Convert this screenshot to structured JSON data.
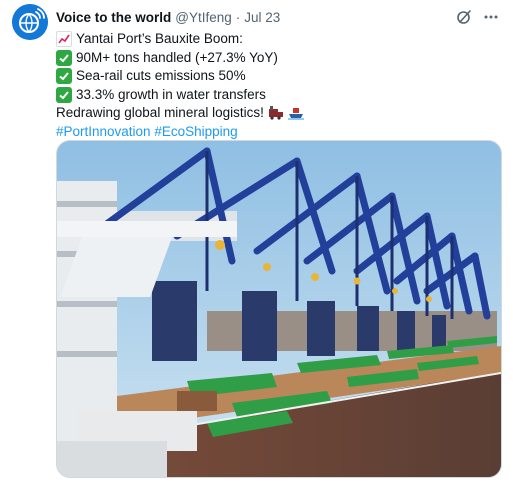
{
  "author": {
    "name": "Voice to the world",
    "handle": "@YtIfeng",
    "separator": "·",
    "date": "Jul 23",
    "avatar_icon": "globe-voice-icon"
  },
  "actions": {
    "grok_icon": "grok-icon",
    "more_icon": "more-icon",
    "more_label": "···"
  },
  "tweet": {
    "lines": [
      {
        "emoji": "chart-increasing-icon",
        "text": "Yantai Port’s Bauxite Boom:"
      },
      {
        "emoji": "check-mark-icon",
        "text": "90M+ tons handled (+27.3% YoY)"
      },
      {
        "emoji": "check-mark-icon",
        "text": "Sea-rail cuts emissions 50%"
      },
      {
        "emoji": "check-mark-icon",
        "text": "33.3% growth in water transfers"
      }
    ],
    "closing": "Redrawing global mineral logistics!",
    "closing_emojis": [
      "train-icon",
      "ship-icon"
    ],
    "hashtags": [
      "#PortInnovation",
      "#EcoShipping"
    ]
  },
  "media": {
    "alt_subject": "ship-unloader-cranes-photo",
    "colors": {
      "sky": "#a9cfe9",
      "crane_blue": "#22409a",
      "deck_green": "#2f9e46",
      "hull": "#6a4a3c",
      "ore": "#b9875a"
    }
  },
  "colors": {
    "link": "#1d9bf0",
    "muted": "#536471",
    "text": "#0f1419",
    "check": "#2fa844",
    "avatar": "#1479d6"
  }
}
